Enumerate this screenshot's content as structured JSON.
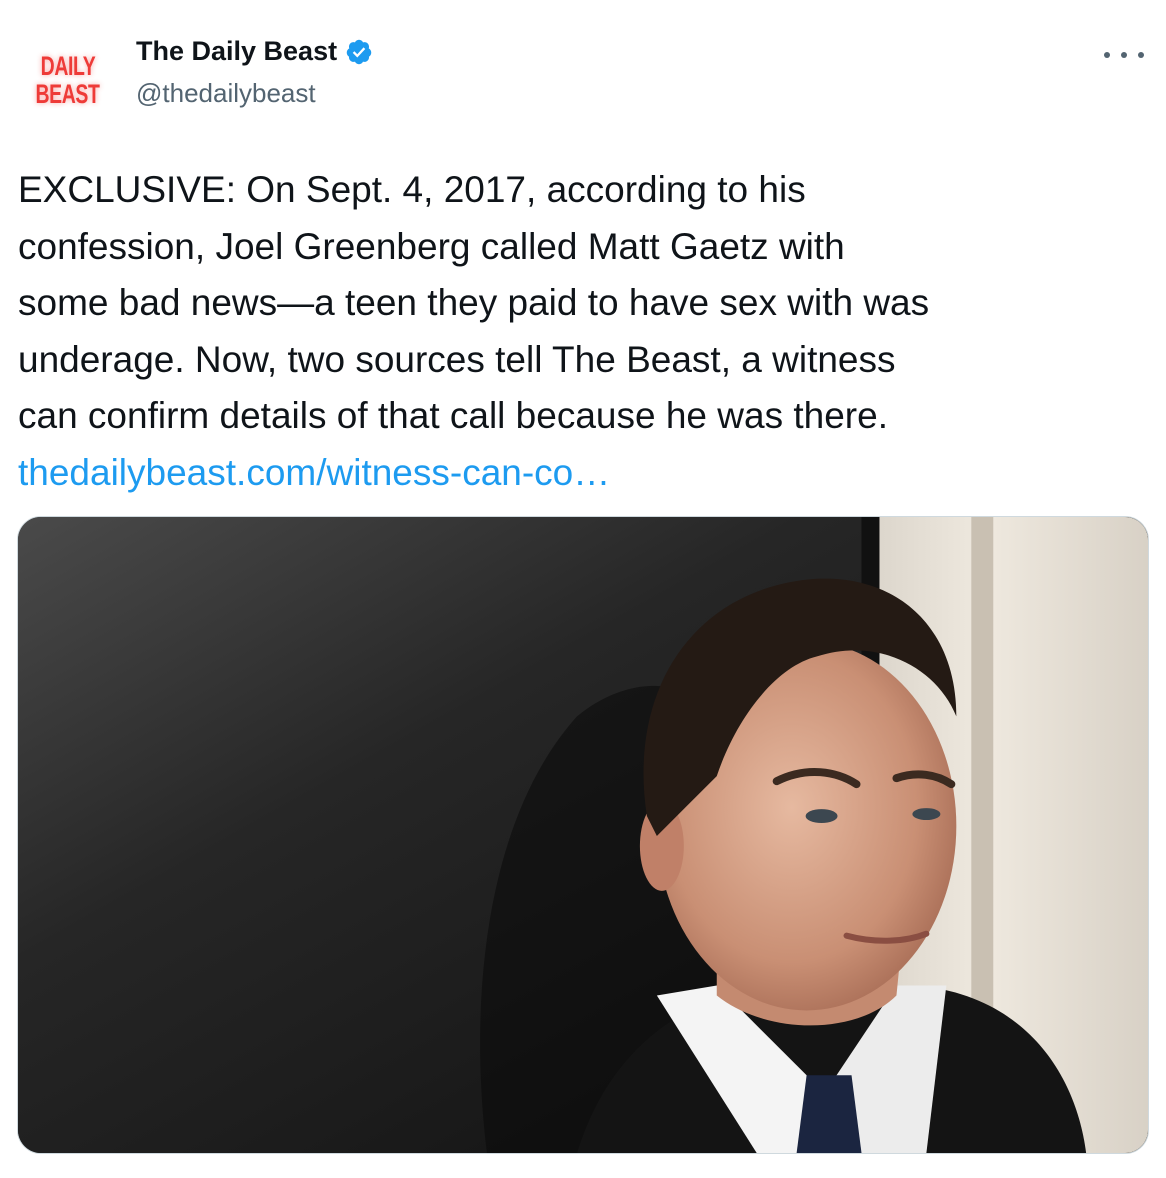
{
  "author": {
    "logo": {
      "line1": "DAILY",
      "line2": "BEAST"
    },
    "display_name": "The Daily Beast",
    "handle": "@thedailybeast",
    "verified": true,
    "verified_icon": "verified-badge-icon"
  },
  "menu": {
    "icon": "more-options-icon"
  },
  "tweet": {
    "lines": [
      "EXCLUSIVE: On Sept. 4, 2017, according to his",
      "confession, Joel Greenberg called Matt Gaetz with",
      "some bad news—a teen they paid to have sex with was",
      "underage. Now, two sources tell The Beast, a witness",
      "can confirm details of that call because he was there."
    ],
    "link": "thedailybeast.com/witness-can-co…"
  },
  "colors": {
    "link": "#1d9bf0",
    "verified": "#1d9bf0",
    "logo": "#ee3b38",
    "secondary_text": "#536471"
  }
}
